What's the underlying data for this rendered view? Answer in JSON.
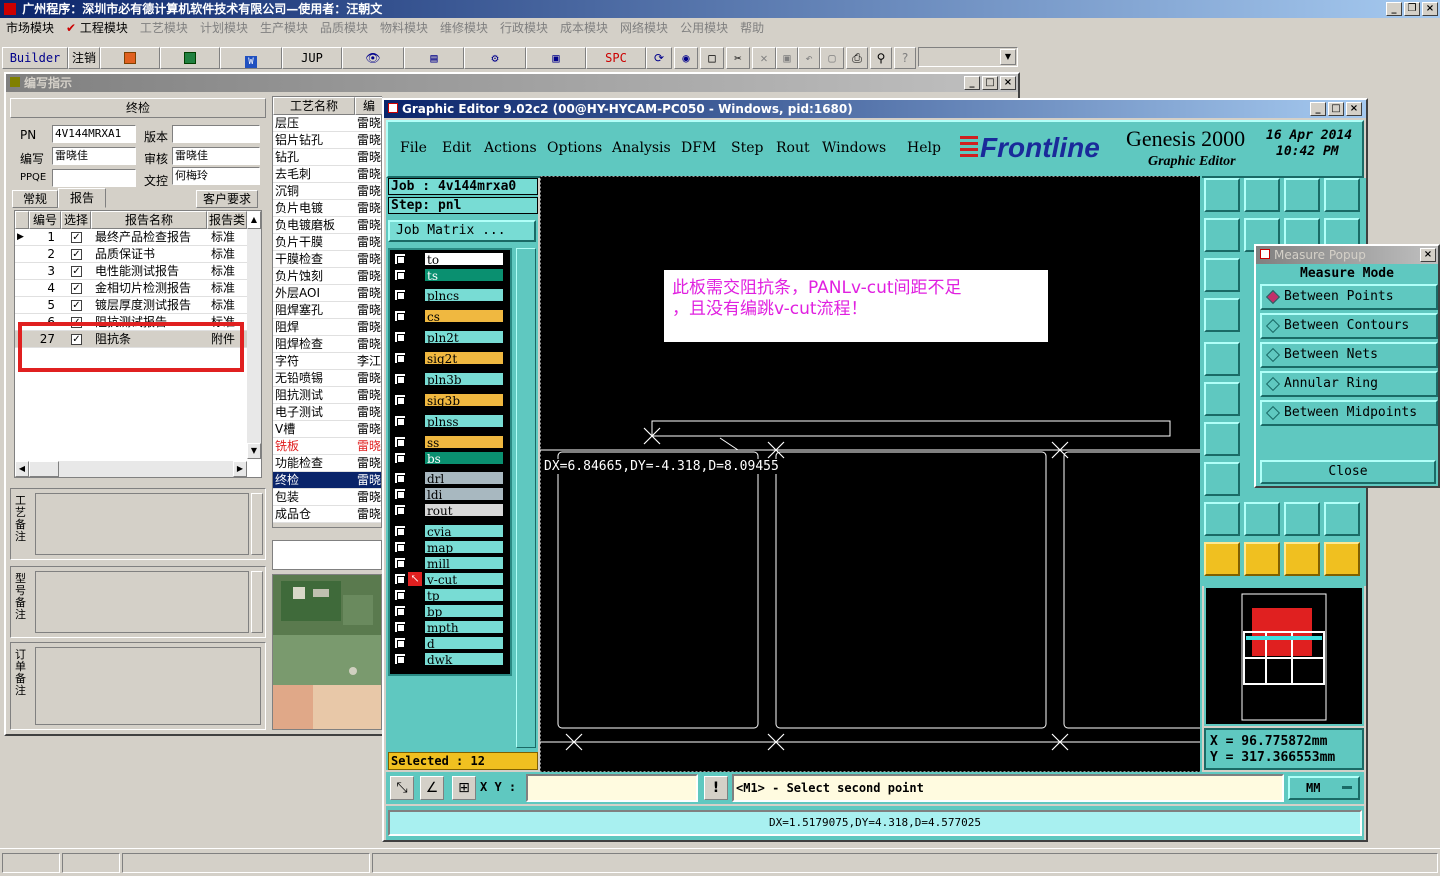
{
  "app": {
    "title": "广州程序：深圳市必有德计算机软件技术有限公司—使用者：汪朝文",
    "menu": [
      "市场模块",
      "工程模块",
      "工艺模块",
      "计划模块",
      "生产模块",
      "品质模块",
      "物料模块",
      "维修模块",
      "行政模块",
      "成本模块",
      "网络模块",
      "公用模块",
      "帮助"
    ],
    "toolbar": {
      "builder": "Builder",
      "logout": "注销",
      "jup": "JUP",
      "spc": "SPC"
    }
  },
  "left": {
    "title": "编写指示",
    "section": "终检",
    "fields": {
      "pn_label": "PN",
      "pn_value": "4V144MRXA1",
      "version_label": "版本",
      "version_value": "",
      "writer_label": "编写",
      "writer_value": "雷晓佳",
      "review_label": "审核",
      "review_value": "雷晓佳",
      "pfqe_label": "PPQE",
      "pfqe_value": "",
      "doc_label": "文控",
      "doc_value": "何梅玲"
    },
    "tabs": [
      "常规",
      "报告",
      "客户要求"
    ],
    "grid_headers": [
      "编号",
      "选择",
      "报告名称",
      "报告类"
    ],
    "reports": [
      {
        "no": "1",
        "name": "最终产品检查报告",
        "type": "标准",
        "checked": true,
        "current": true
      },
      {
        "no": "2",
        "name": "品质保证书",
        "type": "标准",
        "checked": true
      },
      {
        "no": "3",
        "name": "电性能测试报告",
        "type": "标准",
        "checked": true
      },
      {
        "no": "4",
        "name": "金相切片检测报告",
        "type": "标准",
        "checked": true
      },
      {
        "no": "5",
        "name": "镀层厚度测试报告",
        "type": "标准",
        "checked": true
      },
      {
        "no": "6",
        "name": "阻抗测试报告",
        "type": "标准",
        "checked": true
      },
      {
        "no": "27",
        "name": "阻抗条",
        "type": "附件",
        "checked": true
      }
    ],
    "notes": [
      "工艺备注",
      "型号备注",
      "订单备注"
    ],
    "process_headers": [
      "工艺名称",
      "编"
    ],
    "processes": [
      {
        "name": "层压",
        "who": "雷晓"
      },
      {
        "name": "铝片钻孔",
        "who": "雷晓"
      },
      {
        "name": "钻孔",
        "who": "雷晓"
      },
      {
        "name": "去毛刺",
        "who": "雷晓"
      },
      {
        "name": "沉铜",
        "who": "雷晓"
      },
      {
        "name": "负片电镀",
        "who": "雷晓"
      },
      {
        "name": "负电镀磨板",
        "who": "雷晓"
      },
      {
        "name": "负片干膜",
        "who": "雷晓"
      },
      {
        "name": "干膜检查",
        "who": "雷晓"
      },
      {
        "name": "负片蚀刻",
        "who": "雷晓"
      },
      {
        "name": "外层AOI",
        "who": "雷晓"
      },
      {
        "name": "阻焊塞孔",
        "who": "雷晓"
      },
      {
        "name": "阻焊",
        "who": "雷晓"
      },
      {
        "name": "阻焊检查",
        "who": "雷晓"
      },
      {
        "name": "字符",
        "who": "李江"
      },
      {
        "name": "无铅喷锡",
        "who": "雷晓"
      },
      {
        "name": "阻抗测试",
        "who": "雷晓"
      },
      {
        "name": "电子测试",
        "who": "雷晓"
      },
      {
        "name": "V槽",
        "who": "雷晓"
      },
      {
        "name": "铣板",
        "who": "雷晓",
        "red": true
      },
      {
        "name": "功能检查",
        "who": "雷晓"
      },
      {
        "name": "终检",
        "who": "雷晓",
        "selected": true
      },
      {
        "name": "包装",
        "who": "雷晓"
      },
      {
        "name": "成品仓",
        "who": "雷晓"
      }
    ]
  },
  "ge": {
    "title": "Graphic Editor 9.02c2 (00@HY-HYCAM-PC050 - Windows, pid:1680)",
    "menu": [
      "File",
      "Edit",
      "Actions",
      "Options",
      "Analysis",
      "DFM",
      "Step",
      "Rout",
      "Windows",
      "Help"
    ],
    "brand": "Frontline",
    "product": "Genesis 2000",
    "product_sub": "Graphic Editor",
    "date": "16 Apr  2014",
    "time": "10:42 PM",
    "job": "Job  : 4v144mrxa0",
    "step": "Step: pnl",
    "job_matrix": "Job Matrix ...",
    "layers": [
      {
        "name": "to",
        "color": "#ffffff"
      },
      {
        "name": "ts",
        "color": "#0a9070"
      },
      {
        "name": "plncs",
        "color": "#78dcd4"
      },
      {
        "name": "cs",
        "color": "#f0b840"
      },
      {
        "name": "pln2t",
        "color": "#78dcd4"
      },
      {
        "name": "sig2t",
        "color": "#f0b840"
      },
      {
        "name": "pln3b",
        "color": "#78dcd4"
      },
      {
        "name": "sig3b",
        "color": "#f0b840"
      },
      {
        "name": "plnss",
        "color": "#78dcd4"
      },
      {
        "name": "ss",
        "color": "#f0b840"
      },
      {
        "name": "bs",
        "color": "#0a9070"
      },
      {
        "name": "drl",
        "color": "#a8b8c0"
      },
      {
        "name": "ldi",
        "color": "#a8b8c0"
      },
      {
        "name": "rout",
        "color": "#d8d8d8"
      },
      {
        "name": "cvia",
        "color": "#78dcd4"
      },
      {
        "name": "map",
        "color": "#78dcd4"
      },
      {
        "name": "mill",
        "color": "#78dcd4"
      },
      {
        "name": "v-cut",
        "color": "#78dcd4",
        "active": true
      },
      {
        "name": "tp",
        "color": "#78dcd4"
      },
      {
        "name": "bp",
        "color": "#78dcd4"
      },
      {
        "name": "mpth",
        "color": "#78dcd4"
      },
      {
        "name": "d",
        "color": "#78dcd4"
      },
      {
        "name": "dwk",
        "color": "#78dcd4"
      }
    ],
    "selected": "Selected : 12",
    "note_line1": "此板需交阻抗条，PANLv-cut间距不足",
    "note_line2": "，且没有编跳v-cut流程！",
    "measure_readout": "DX=6.84665,DY=-4.318,D=8.09455",
    "xy_label": "X Y :",
    "xy_value": "",
    "prompt": "<M1> - Select second point",
    "units": "MM",
    "status": "DX=1.5179075,DY=4.318,D=4.577025",
    "coord_x": "X  =  96.775872mm",
    "coord_y": "Y  =  317.366553mm"
  },
  "measure": {
    "title": "Measure Popup",
    "heading": "Measure Mode",
    "options": [
      "Between Points",
      "Between Contours",
      "Between Nets",
      "Annular Ring",
      "Between Midpoints"
    ],
    "selected_index": 0,
    "close": "Close"
  },
  "colors": {
    "teal": "#5fc8c0",
    "canvas": "#000000",
    "accent": "#c0306a"
  }
}
